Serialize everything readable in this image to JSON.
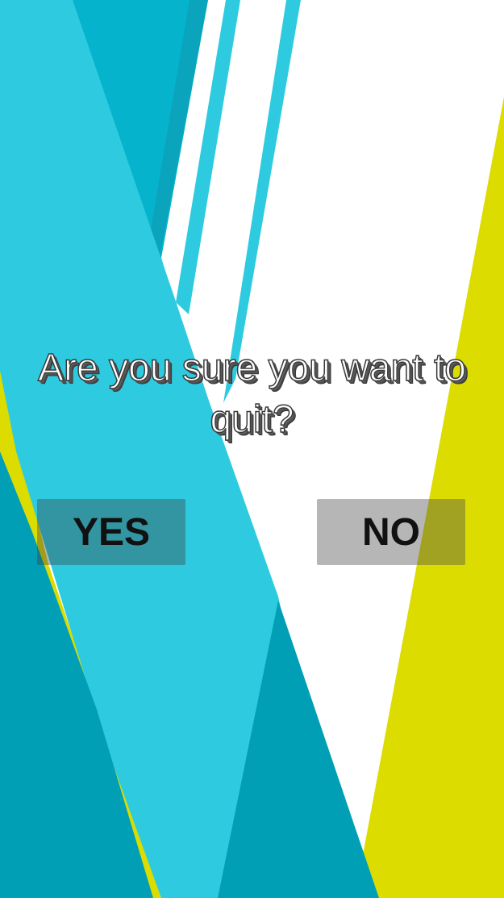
{
  "dialog": {
    "question": "Are you sure you want to quit?",
    "yes_label": "YES",
    "no_label": "NO"
  },
  "colors": {
    "cyan_light": "#2ecbe0",
    "cyan_mid": "#05b3cd",
    "teal_dark": "#009fb5",
    "yellow": "#dcdc00",
    "white": "#ffffff"
  }
}
